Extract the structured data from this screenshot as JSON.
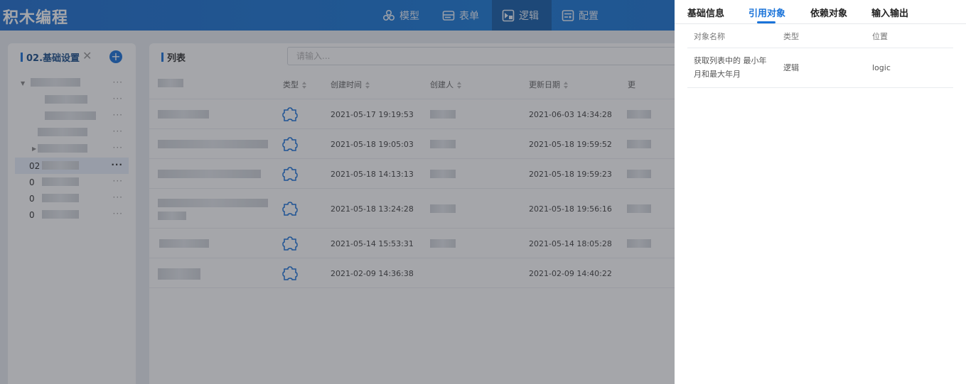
{
  "app": {
    "title": "积木编程"
  },
  "nav": [
    {
      "label": "模型",
      "icon": "model-icon"
    },
    {
      "label": "表单",
      "icon": "form-icon"
    },
    {
      "label": "逻辑",
      "icon": "logic-icon",
      "active": true
    },
    {
      "label": "配置",
      "icon": "config-icon"
    }
  ],
  "left_panel": {
    "title": "02.基础设置",
    "items": [
      {
        "prefix": ""
      },
      {
        "prefix": ""
      },
      {
        "prefix": ""
      },
      {
        "prefix": ""
      },
      {
        "prefix": ""
      },
      {
        "prefix": "02",
        "selected": true
      },
      {
        "prefix": "0"
      },
      {
        "prefix": "0"
      },
      {
        "prefix": "0"
      }
    ]
  },
  "list_panel": {
    "title": "列表",
    "search_placeholder": "请输入...",
    "columns": {
      "type": "类型",
      "created": "创建时间",
      "creator": "创建人",
      "updated": "更新日期",
      "updater": "更"
    },
    "rows": [
      {
        "created": "2021-05-17 19:19:53",
        "updated": "2021-06-03 14:34:28"
      },
      {
        "created": "2021-05-18 19:05:03",
        "updated": "2021-05-18 19:59:52"
      },
      {
        "created": "2021-05-18 14:13:13",
        "updated": "2021-05-18 19:59:23"
      },
      {
        "created": "2021-05-18 13:24:28",
        "updated": "2021-05-18 19:56:16"
      },
      {
        "created": "2021-05-14 15:53:31",
        "updated": "2021-05-14 18:05:28"
      },
      {
        "created": "2021-02-09 14:36:38",
        "updated": "2021-02-09 14:40:22"
      }
    ]
  },
  "drawer": {
    "tabs": [
      "基础信息",
      "引用对象",
      "依赖对象",
      "输入输出"
    ],
    "active_tab": 1,
    "columns": [
      "对象名称",
      "类型",
      "位置"
    ],
    "rows": [
      {
        "name": "获取列表中的 最小年月和最大年月",
        "type": "逻辑",
        "location": "logic"
      }
    ]
  },
  "colors": {
    "accent": "#1a73d9",
    "topbar": "#1f6fcf"
  }
}
